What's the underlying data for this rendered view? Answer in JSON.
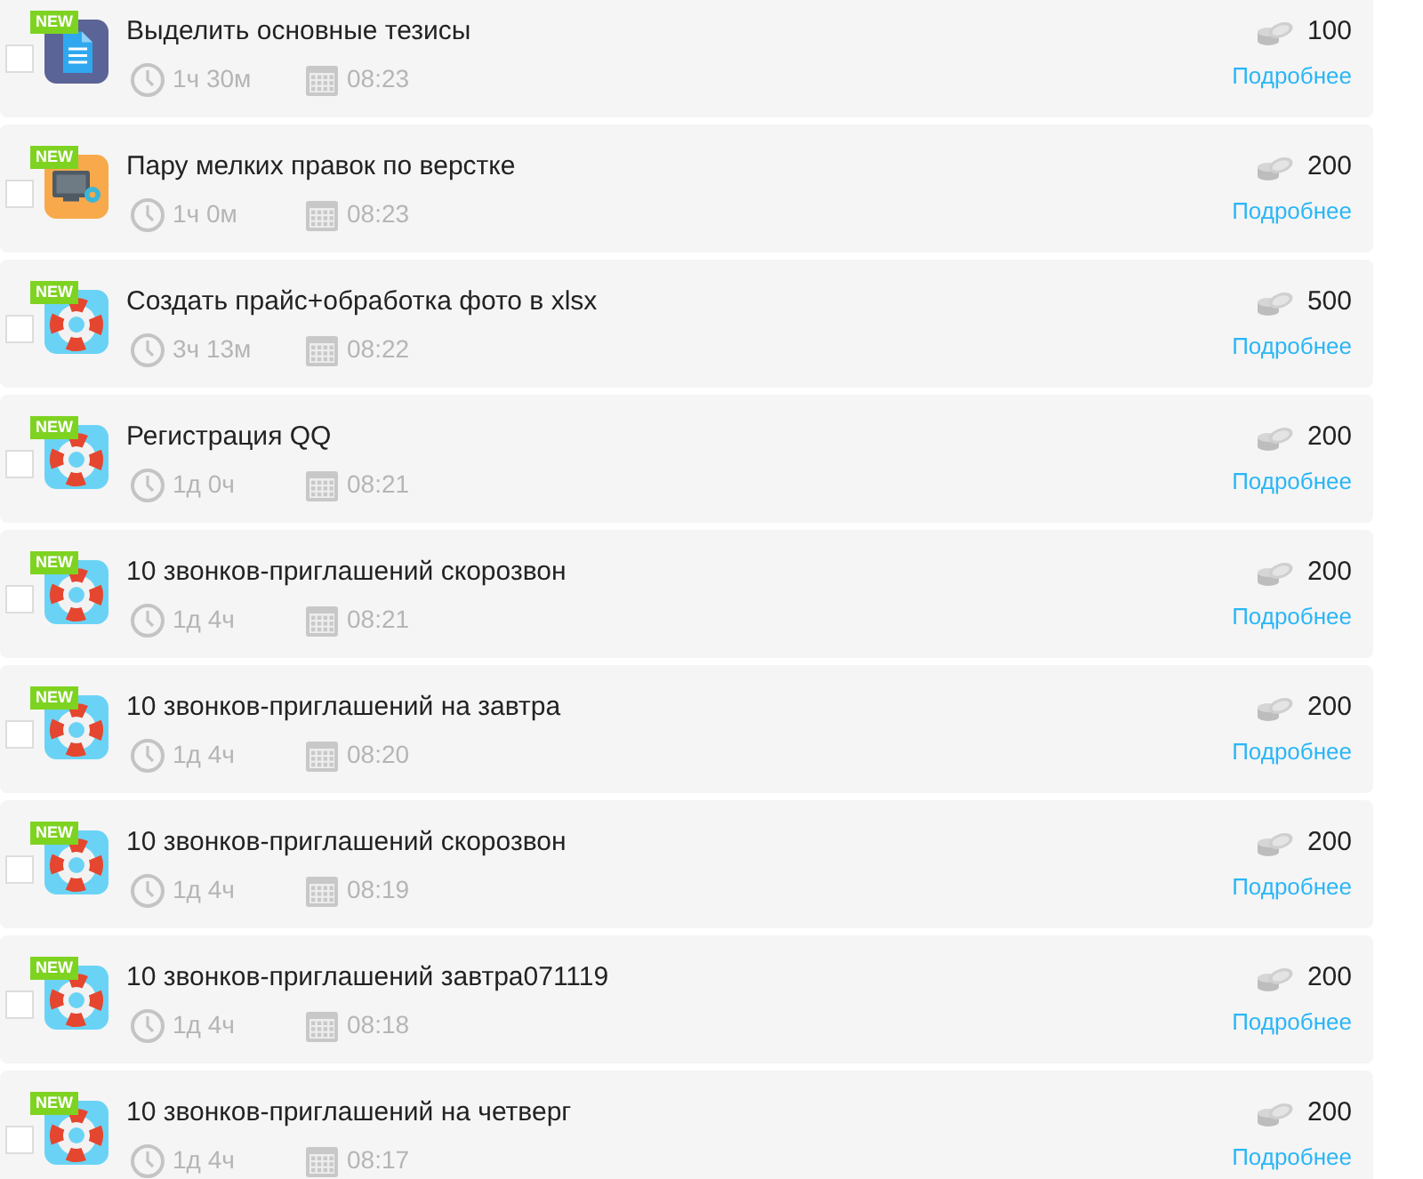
{
  "tasks": [
    {
      "kind": "document",
      "badge": "NEW",
      "checked": false,
      "title": "Выделить основные тезисы",
      "duration": "1ч 30м",
      "time": "08:23",
      "price": "100",
      "link": "Подробнее"
    },
    {
      "kind": "monitor",
      "badge": "NEW",
      "checked": false,
      "title": "Пару мелких правок по верстке",
      "duration": "1ч 0м",
      "time": "08:23",
      "price": "200",
      "link": "Подробнее"
    },
    {
      "kind": "lifebuoy",
      "badge": "NEW",
      "checked": false,
      "title": "Создать прайс+обработка фото в xlsx",
      "duration": "3ч 13м",
      "time": "08:22",
      "price": "500",
      "link": "Подробнее"
    },
    {
      "kind": "lifebuoy",
      "badge": "NEW",
      "checked": false,
      "title": "Регистрация QQ",
      "duration": "1д 0ч",
      "time": "08:21",
      "price": "200",
      "link": "Подробнее"
    },
    {
      "kind": "lifebuoy",
      "badge": "NEW",
      "checked": false,
      "title": "10 звонков-приглашений скорозвон",
      "duration": "1д 4ч",
      "time": "08:21",
      "price": "200",
      "link": "Подробнее"
    },
    {
      "kind": "lifebuoy",
      "badge": "NEW",
      "checked": false,
      "title": "10 звонков-приглашений на завтра",
      "duration": "1д 4ч",
      "time": "08:20",
      "price": "200",
      "link": "Подробнее"
    },
    {
      "kind": "lifebuoy",
      "badge": "NEW",
      "checked": false,
      "title": "10 звонков-приглашений скорозвон",
      "duration": "1д 4ч",
      "time": "08:19",
      "price": "200",
      "link": "Подробнее"
    },
    {
      "kind": "lifebuoy",
      "badge": "NEW",
      "checked": false,
      "title": "10 звонков-приглашений завтра071119",
      "duration": "1д 4ч",
      "time": "08:18",
      "price": "200",
      "link": "Подробнее"
    },
    {
      "kind": "lifebuoy",
      "badge": "NEW",
      "checked": false,
      "title": "10 звонков-приглашений на четверг",
      "duration": "1д 4ч",
      "time": "08:17",
      "price": "200",
      "link": "Подробнее"
    }
  ]
}
